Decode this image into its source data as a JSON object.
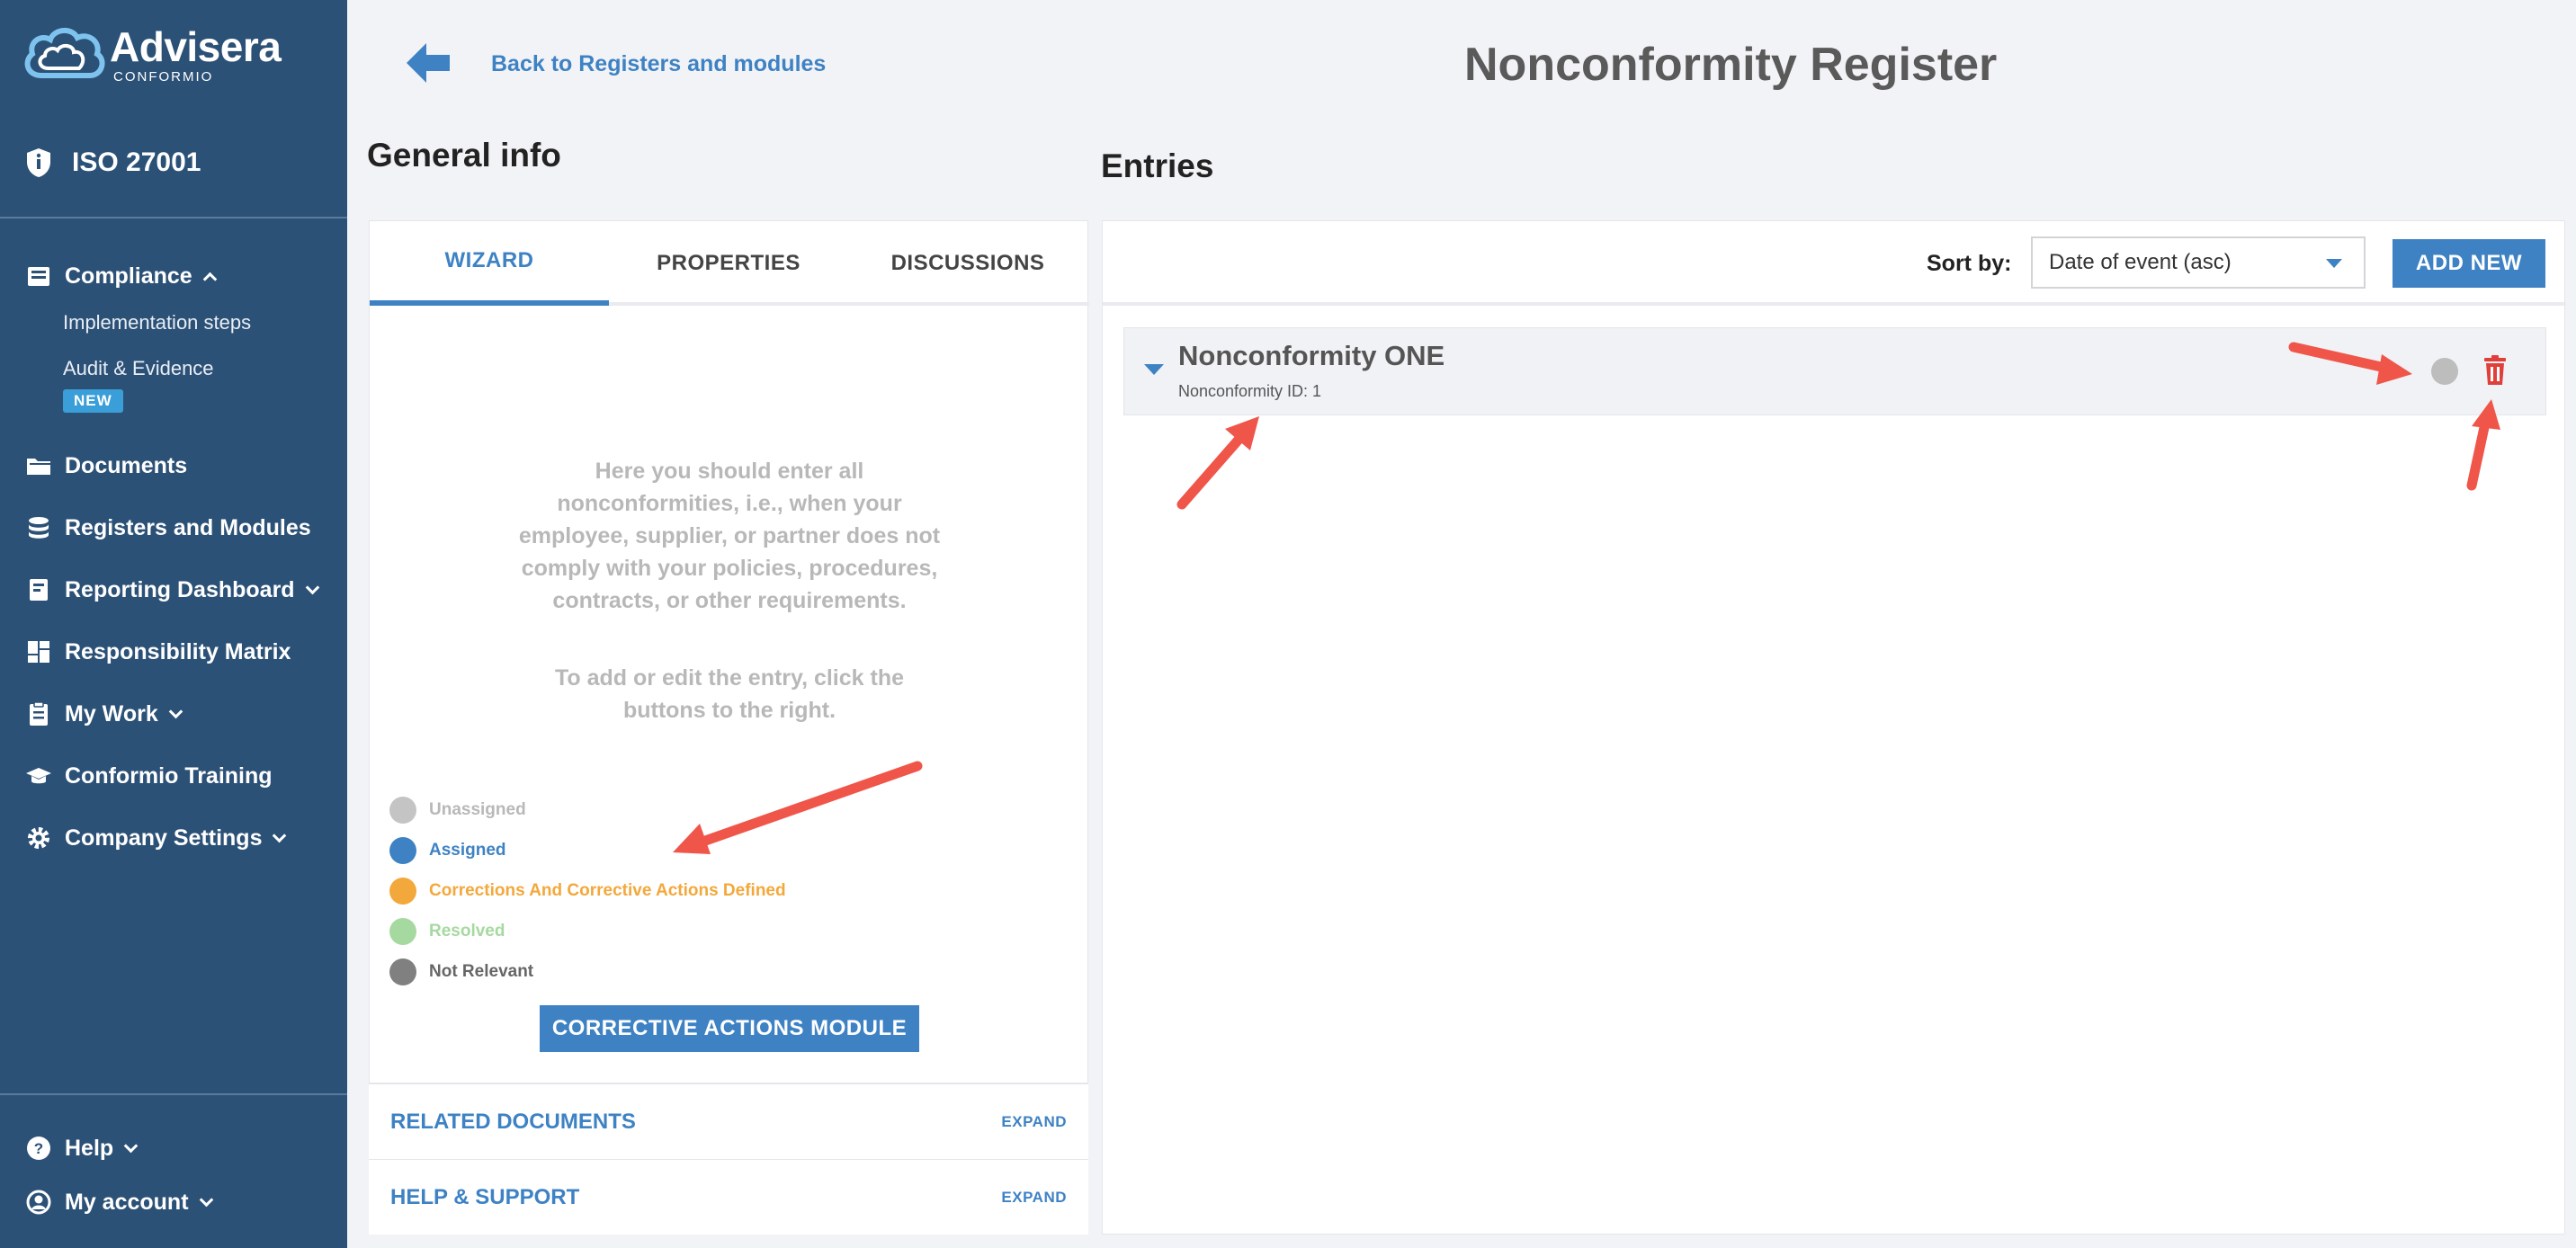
{
  "sidebar": {
    "logo": {
      "name": "Advisera",
      "sub": "CONFORMIO"
    },
    "standard": "ISO 27001",
    "compliance": {
      "label": "Compliance",
      "subitems": [
        "Implementation steps",
        "Audit & Evidence"
      ],
      "badge": "NEW"
    },
    "items": [
      {
        "label": "Documents"
      },
      {
        "label": "Registers and Modules"
      },
      {
        "label": "Reporting Dashboard"
      },
      {
        "label": "Responsibility Matrix"
      },
      {
        "label": "My Work"
      },
      {
        "label": "Conformio Training"
      },
      {
        "label": "Company Settings"
      }
    ],
    "bottom": [
      {
        "label": "Help"
      },
      {
        "label": "My account"
      }
    ]
  },
  "header": {
    "back_label": "Back to Registers and modules",
    "title": "Nonconformity Register"
  },
  "general_info": {
    "title": "General info",
    "tabs": [
      "WIZARD",
      "PROPERTIES",
      "DISCUSSIONS"
    ],
    "text1": "Here you should enter all nonconformities, i.e., when your employee, supplier, or partner does not comply with your policies, procedures, contracts, or other requirements.",
    "text2": "To add or edit the entry, click the buttons to the right.",
    "legend": [
      {
        "label": "Unassigned",
        "color": "#c4c4c4"
      },
      {
        "label": "Assigned",
        "color": "#3e82c4"
      },
      {
        "label": "Corrections And Corrective Actions Defined",
        "color": "#f3a83b"
      },
      {
        "label": "Resolved",
        "color": "#a6d9a0"
      },
      {
        "label": "Not Relevant",
        "color": "#808080"
      }
    ],
    "module_button": "CORRECTIVE ACTIONS MODULE",
    "accordions": [
      {
        "title": "RELATED DOCUMENTS",
        "action": "EXPAND"
      },
      {
        "title": "HELP & SUPPORT",
        "action": "EXPAND"
      }
    ]
  },
  "entries": {
    "title": "Entries",
    "sort_label": "Sort by:",
    "sort_value": "Date of event (asc)",
    "add_button": "ADD NEW",
    "items": [
      {
        "title": "Nonconformity ONE",
        "id_text": "Nonconformity ID: 1"
      }
    ]
  },
  "colors": {
    "sidebar": "#2c5177",
    "accent": "#3e82c4",
    "danger": "#e0403a",
    "annotation": "#f0554a"
  }
}
